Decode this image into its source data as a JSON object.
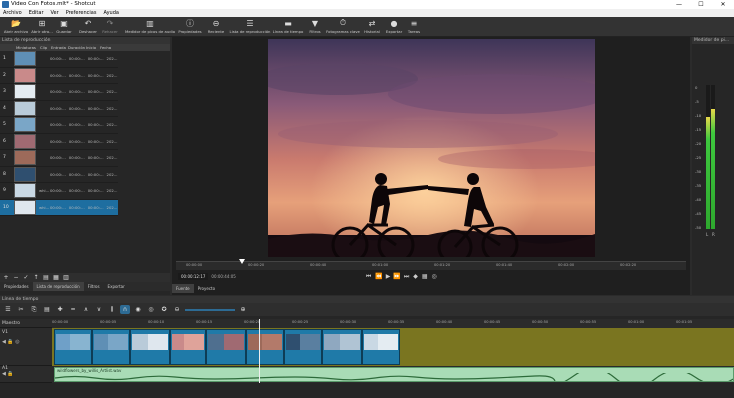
{
  "window": {
    "title": "Video Con Fotos.mlt* - Shotcut",
    "minimize": "—",
    "maximize": "☐",
    "close": "✕"
  },
  "menu": [
    "Archivo",
    "Editar",
    "Ver",
    "Preferencias",
    "Ayuda"
  ],
  "toolbar": [
    {
      "label": "Abrir archivo",
      "icon": "open-file-icon"
    },
    {
      "label": "Abrir otro...",
      "icon": "open-other-icon"
    },
    {
      "label": "Guardar",
      "icon": "save-icon"
    },
    {
      "label": "Deshacer",
      "icon": "undo-icon"
    },
    {
      "label": "Rehacer",
      "icon": "redo-icon"
    },
    {
      "label": "Medidor de picos de audio",
      "icon": "peak-meter-icon"
    },
    {
      "label": "Propiedades",
      "icon": "properties-icon"
    },
    {
      "label": "Reciente",
      "icon": "recent-icon"
    },
    {
      "label": "Lista de reproducción",
      "icon": "playlist-icon"
    },
    {
      "label": "Línea de tiempo",
      "icon": "timeline-icon"
    },
    {
      "label": "Filtros",
      "icon": "filters-icon"
    },
    {
      "label": "Fotogramas clave",
      "icon": "keyframes-icon"
    },
    {
      "label": "Historial",
      "icon": "history-icon"
    },
    {
      "label": "Exportar",
      "icon": "export-icon"
    },
    {
      "label": "Tareas",
      "icon": "jobs-icon"
    }
  ],
  "playlist": {
    "title": "Lista de reproducción",
    "columns": [
      "Miniaturas",
      "Clip",
      "Entrada",
      "Duración",
      "Inicio",
      "Fecha"
    ],
    "rows": [
      {
        "num": "1",
        "clip": "",
        "in": "00:00:...",
        "dur": "00:00:...",
        "start": "00:00:...",
        "date": "202..."
      },
      {
        "num": "2",
        "clip": "",
        "in": "00:00:...",
        "dur": "00:00:...",
        "start": "00:00:...",
        "date": "202..."
      },
      {
        "num": "3",
        "clip": "",
        "in": "00:00:...",
        "dur": "00:00:...",
        "start": "00:00:...",
        "date": "202..."
      },
      {
        "num": "4",
        "clip": "",
        "in": "00:00:...",
        "dur": "00:00:...",
        "start": "00:00:...",
        "date": "202..."
      },
      {
        "num": "5",
        "clip": "",
        "in": "00:00:...",
        "dur": "00:00:...",
        "start": "00:00:...",
        "date": "202..."
      },
      {
        "num": "6",
        "clip": "",
        "in": "00:00:...",
        "dur": "00:00:...",
        "start": "00:00:...",
        "date": "202..."
      },
      {
        "num": "7",
        "clip": "",
        "in": "00:00:...",
        "dur": "00:00:...",
        "start": "00:00:...",
        "date": "202..."
      },
      {
        "num": "8",
        "clip": "",
        "in": "00:00:...",
        "dur": "00:00:...",
        "start": "00:00:...",
        "date": "202..."
      },
      {
        "num": "9",
        "clip": "whi...",
        "in": "00:00:...",
        "dur": "00:00:...",
        "start": "00:00:...",
        "date": "202..."
      },
      {
        "num": "10",
        "clip": "whi...",
        "in": "00:00:...",
        "dur": "00:00:...",
        "start": "00:00:...",
        "date": "202..."
      }
    ],
    "tools": [
      "+",
      "−",
      "✓",
      "↑",
      "▤",
      "▦",
      "▥"
    ],
    "tabs": [
      "Propiedades",
      "Lista de reproducción",
      "Filtros",
      "Exportar"
    ]
  },
  "viewer": {
    "ruler_ticks": [
      "00:00:00",
      "00:00:20",
      "00:00:40",
      "00:01:00",
      "00:01:20",
      "00:01:40",
      "00:02:00",
      "00:02:20"
    ],
    "timecode": "00:00:12:17",
    "duration": "00:00:44:05",
    "tabs": [
      "Fuente",
      "Proyecto"
    ],
    "playhead_fraction": 0.13
  },
  "meter": {
    "title": "Medidor de pi...",
    "ticks": [
      "0",
      "-5",
      "-10",
      "-15",
      "-20",
      "-25",
      "-30",
      "-35",
      "-40",
      "-45",
      "-50"
    ],
    "left_label": "L",
    "right_label": "R",
    "left_level": 0.78,
    "right_level": 0.83
  },
  "timeline": {
    "title": "Línea de tiempo",
    "ruler_ticks": [
      "00:00:00",
      "00:00:05",
      "00:00:10",
      "00:00:15",
      "00:00:20",
      "00:00:25",
      "00:00:30",
      "00:00:35",
      "00:00:40",
      "00:00:45",
      "00:00:50",
      "00:00:55",
      "00:01:00",
      "00:01:05"
    ],
    "master_label": "Maestro",
    "video_track": "V1",
    "audio_track": "A1",
    "audio_clip": "wildflowers_by_willis_Artlist.wav"
  }
}
